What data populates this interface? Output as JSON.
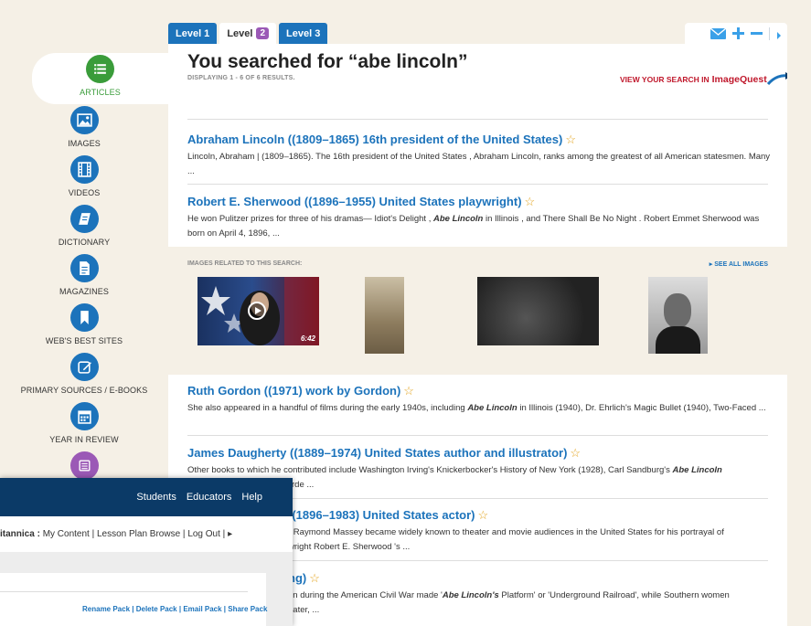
{
  "tabs": [
    {
      "label": "Level 1"
    },
    {
      "label": "Level",
      "badge": "2"
    },
    {
      "label": "Level 3"
    }
  ],
  "tools": {
    "icons": [
      "mail-icon",
      "plus-icon",
      "minus-icon",
      "chevron-right-icon"
    ]
  },
  "sidebar": {
    "items": [
      {
        "label": "ARTICLES",
        "icon": "list-icon"
      },
      {
        "label": "IMAGES",
        "icon": "image-icon"
      },
      {
        "label": "VIDEOS",
        "icon": "film-icon"
      },
      {
        "label": "DICTIONARY",
        "icon": "book-icon"
      },
      {
        "label": "MAGAZINES",
        "icon": "document-icon"
      },
      {
        "label": "WEB'S BEST SITES",
        "icon": "bookmark-icon"
      },
      {
        "label": "PRIMARY SOURCES / E-BOOKS",
        "icon": "edit-icon"
      },
      {
        "label": "YEAR IN REVIEW",
        "icon": "calendar-icon"
      },
      {
        "label": "",
        "icon": "list-icon"
      }
    ]
  },
  "search": {
    "heading": "You searched for “abe lincoln”",
    "count": "DISPLAYING 1 - 6 OF 6 RESULTS.",
    "imagequest_prefix": "VIEW YOUR SEARCH IN",
    "imagequest_brand": "ImageQuest"
  },
  "results": [
    {
      "title": "Abraham Lincoln ((1809–1865) 16th president of the United States)",
      "snippet": "Lincoln, Abraham  |  (1809–1865). The 16th president of the United States , Abraham Lincoln, ranks among the greatest of all American statesmen. Many ..."
    },
    {
      "title": "Robert E. Sherwood ((1896–1955) United States playwright)",
      "snippet_pre": "He won Pulitzer prizes for three of his dramas— Idiot's Delight , ",
      "snippet_em": "Abe Lincoln",
      "snippet_post": " in Illinois , and There Shall Be No Night .  Robert Emmet Sherwood was born on April 4, 1896, ..."
    },
    {
      "title": "Ruth Gordon ((1971) work by Gordon)",
      "snippet_pre": "She also appeared in a handful of films during the early 1940s, including ",
      "snippet_em": "Abe Lincoln",
      "snippet_post": " in Illinois (1940), Dr. Ehrlich's Magic Bullet (1940), Two-Faced ..."
    },
    {
      "title": "James Daugherty ((1889–1974) United States author and illustrator)",
      "snippet_pre": "Other books to which he contributed include Washington Irving's Knickerbocker's History of New York (1928), Carl Sandburg's ",
      "snippet_em": "Abe Lincoln",
      "snippet_post": "",
      "snippet_line2": "rde ..."
    },
    {
      "title": "((1896–1983) United States actor)",
      "snippet": "r Raymond Massey became widely known to theater and movie audiences in the United States for his portrayal of",
      "snippet_line2": "wright Robert E. Sherwood 's ..."
    },
    {
      "title": "ng)",
      "snippet_pre": "on during the American Civil War made '",
      "snippet_em": "Abe Lincoln's",
      "snippet_post": " Platform' or 'Underground Railroad', while Southern women",
      "snippet_line2": "Later, ..."
    }
  ],
  "images": {
    "caption": "IMAGES RELATED TO THIS SEARCH:",
    "see_all": "SEE ALL IMAGES",
    "video_duration": "6:42"
  },
  "back_window": {
    "nav": [
      "Students",
      "Educators",
      "Help"
    ],
    "brand": "itannica :",
    "links": [
      "My Content",
      "Lesson Plan Browse",
      "Log Out"
    ],
    "actions": "Rename Pack | Delete Pack | Email Pack | Share Pack"
  },
  "colors": {
    "accent": "#1c73bb",
    "active": "#3a9c3a",
    "brand_red": "#c0182c",
    "navy": "#0b3a67"
  }
}
